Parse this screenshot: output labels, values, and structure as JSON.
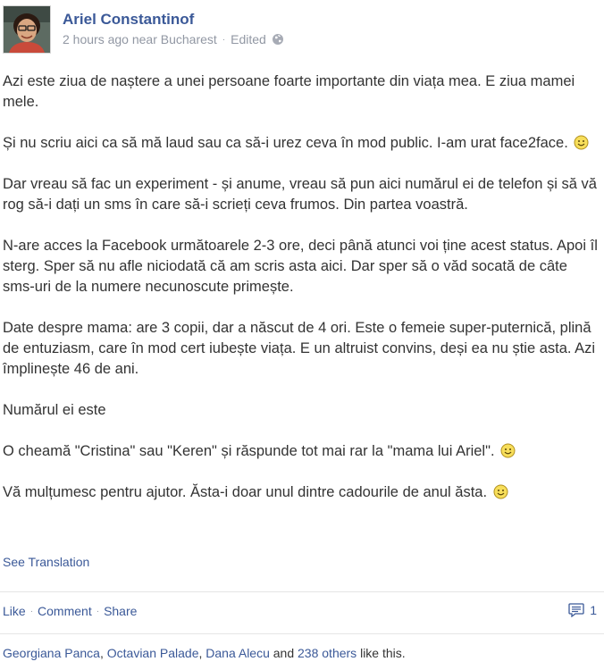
{
  "post": {
    "author": "Ariel Constantinof",
    "time": "2 hours ago near Bucharest",
    "edited": "Edited",
    "paragraphs": [
      "Azi este ziua de naștere a unei persoane foarte importante din viața mea. E ziua mamei mele.",
      "Și nu scriu aici ca să mă laud sau ca să-i urez ceva în mod public. I-am urat face2face.",
      "Dar vreau să fac un experiment - și anume, vreau să pun aici numărul ei de telefon și să vă rog să-i dați un sms în care să-i scrieți ceva frumos. Din partea voastră.",
      "N-are acces la Facebook următoarele 2-3 ore, deci până atunci voi ține acest status. Apoi îl sterg. Sper să nu afle niciodată că am scris asta aici. Dar sper să o văd socată de câte sms-uri de la numere necunoscute primește.",
      "Date despre mama: are 3 copii, dar a născut de 4 ori. Este o femeie super-puternică, plină de entuziasm, care în mod cert iubește viața. E un altruist convins, deși ea nu știe asta. Azi împlinește 46 de ani.",
      "Numărul ei este",
      "O cheamă \"Cristina\" sau \"Keren\" și răspunde tot mai rar la \"mama lui Ariel\".",
      "Vă mulțumesc pentru ajutor. Ăsta-i doar unul dintre cadourile de anul ăsta."
    ],
    "see_translation": "See Translation"
  },
  "actions": {
    "like": "Like",
    "comment": "Comment",
    "share": "Share",
    "comment_count": "1"
  },
  "likes": {
    "names": [
      "Georgiana Panca",
      "Octavian Palade",
      "Dana Alecu"
    ],
    "sep1": ", ",
    "sep2": ", ",
    "and": " and ",
    "others": "238 others",
    "suffix": " like this."
  },
  "icons": {
    "privacy": "globe-icon",
    "emoticon": "smiley-icon",
    "comments": "comment-icon"
  },
  "colors": {
    "link": "#3b5998",
    "meta": "#9197a3",
    "text": "#333333"
  }
}
